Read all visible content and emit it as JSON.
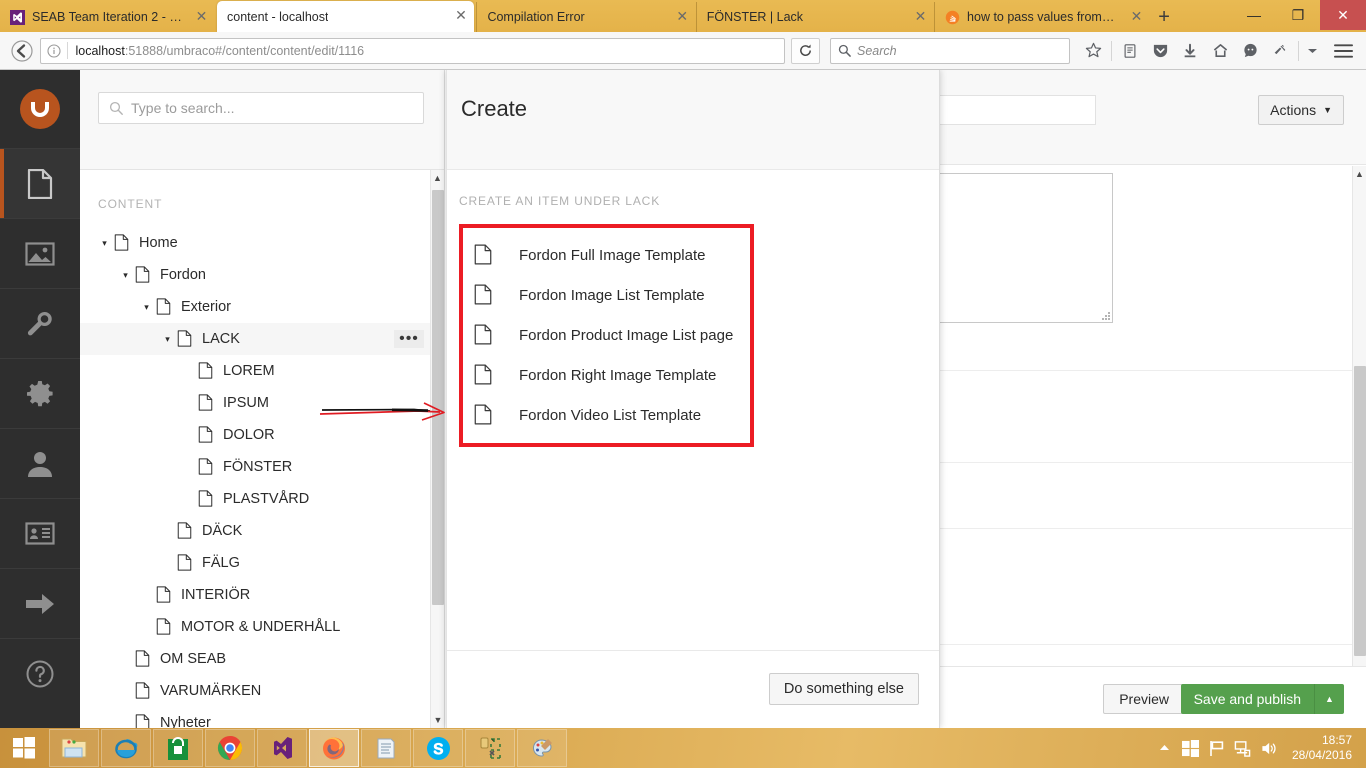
{
  "browser": {
    "tabs": [
      {
        "label": "SEAB Team Iteration 2 - Vi...",
        "favicon": "visual-studio-icon",
        "active": false
      },
      {
        "label": "content - localhost",
        "favicon": "none",
        "active": true
      },
      {
        "label": "Compilation Error",
        "favicon": "none",
        "active": false
      },
      {
        "label": "FÖNSTER | Lack",
        "favicon": "none",
        "active": false
      },
      {
        "label": "how to pass values from o...",
        "favicon": "stackoverflow-icon",
        "active": false
      }
    ],
    "new_tab_label": "+",
    "window_controls": {
      "minimize": "—",
      "restore": "❐",
      "close": "✕"
    },
    "url": {
      "host": "localhost",
      "path": ":51888/umbraco#/content/content/edit/1116"
    },
    "search_placeholder": "Search",
    "toolbar_icons": [
      "bookmark-star-icon",
      "reader-icon",
      "pocket-icon",
      "downloads-icon",
      "home-icon",
      "sync-avatar-icon",
      "extension-icon",
      "overflow-chevron-icon",
      "hamburger-menu-icon"
    ]
  },
  "umbraco": {
    "nav": [
      {
        "name": "content-section",
        "icon": "document-icon",
        "active": true
      },
      {
        "name": "media-section",
        "icon": "image-icon",
        "active": false
      },
      {
        "name": "settings-section",
        "icon": "wrench-icon",
        "active": false
      },
      {
        "name": "developer-section",
        "icon": "gear-icon",
        "active": false
      },
      {
        "name": "users-section",
        "icon": "user-icon",
        "active": false
      },
      {
        "name": "members-section",
        "icon": "member-card-icon",
        "active": false
      },
      {
        "name": "forms-section",
        "icon": "arrow-right-icon",
        "active": false
      },
      {
        "name": "help-section",
        "icon": "help-circle-icon",
        "active": false
      }
    ],
    "tree": {
      "search_placeholder": "Type to search...",
      "header": "CONTENT",
      "options_button_label": "•••",
      "nodes": [
        {
          "label": "Home",
          "depth": 0,
          "caret": "▾",
          "selected": false
        },
        {
          "label": "Fordon",
          "depth": 1,
          "caret": "▾",
          "selected": false
        },
        {
          "label": "Exterior",
          "depth": 2,
          "caret": "▾",
          "selected": false
        },
        {
          "label": "LACK",
          "depth": 3,
          "caret": "▾",
          "selected": true
        },
        {
          "label": "LOREM",
          "depth": 4,
          "caret": "",
          "selected": false
        },
        {
          "label": "IPSUM",
          "depth": 4,
          "caret": "",
          "selected": false
        },
        {
          "label": "DOLOR",
          "depth": 4,
          "caret": "",
          "selected": false
        },
        {
          "label": "FÖNSTER",
          "depth": 4,
          "caret": "",
          "selected": false
        },
        {
          "label": "PLASTVÅRD",
          "depth": 4,
          "caret": "",
          "selected": false
        },
        {
          "label": "DÄCK",
          "depth": 3,
          "caret": "",
          "selected": false
        },
        {
          "label": "FÄLG",
          "depth": 3,
          "caret": "",
          "selected": false
        },
        {
          "label": "INTERIÖR",
          "depth": 2,
          "caret": "",
          "selected": false
        },
        {
          "label": "MOTOR & UNDERHÅLL",
          "depth": 2,
          "caret": "",
          "selected": false
        },
        {
          "label": "OM SEAB",
          "depth": 1,
          "caret": "",
          "selected": false
        },
        {
          "label": "VARUMÄRKEN",
          "depth": 1,
          "caret": "",
          "selected": false
        },
        {
          "label": "Nyheter",
          "depth": 1,
          "caret": "",
          "selected": false
        }
      ]
    },
    "editor": {
      "actions_label": "Actions",
      "name_value": "",
      "preview_label": "Preview",
      "publish_label": "Save and publish",
      "publish_caret": "▲"
    },
    "overlay": {
      "title": "Create",
      "subheading": "CREATE AN ITEM UNDER LACK",
      "items": [
        {
          "label": "Fordon Full Image Template"
        },
        {
          "label": "Fordon Image List Template"
        },
        {
          "label": "Fordon Product Image List page"
        },
        {
          "label": "Fordon Right Image Template"
        },
        {
          "label": "Fordon Video List Template"
        }
      ],
      "footer_button": "Do something else",
      "highlight_color": "#ec1c24"
    }
  },
  "taskbar": {
    "start_label": "start-button",
    "items": [
      {
        "name": "file-explorer",
        "active": false
      },
      {
        "name": "internet-explorer",
        "active": false
      },
      {
        "name": "microsoft-store",
        "active": false
      },
      {
        "name": "google-chrome",
        "active": false
      },
      {
        "name": "visual-studio",
        "active": false
      },
      {
        "name": "mozilla-firefox",
        "active": true
      },
      {
        "name": "notepad",
        "active": false
      },
      {
        "name": "skype",
        "active": false
      },
      {
        "name": "snipping-tool",
        "active": false
      },
      {
        "name": "paint",
        "active": false
      }
    ],
    "tray_icons": [
      "show-hidden-icons",
      "windows-security-icon",
      "flag-icon",
      "network-icon",
      "volume-icon"
    ],
    "time": "18:57",
    "date": "28/04/2016"
  },
  "colors": {
    "firefox_chrome": "#e8b850",
    "umbraco_nav": "#2e2e2e",
    "umbraco_orange": "#b8541e",
    "publish_green": "#55a04d",
    "annotation_red": "#ec1c24"
  }
}
